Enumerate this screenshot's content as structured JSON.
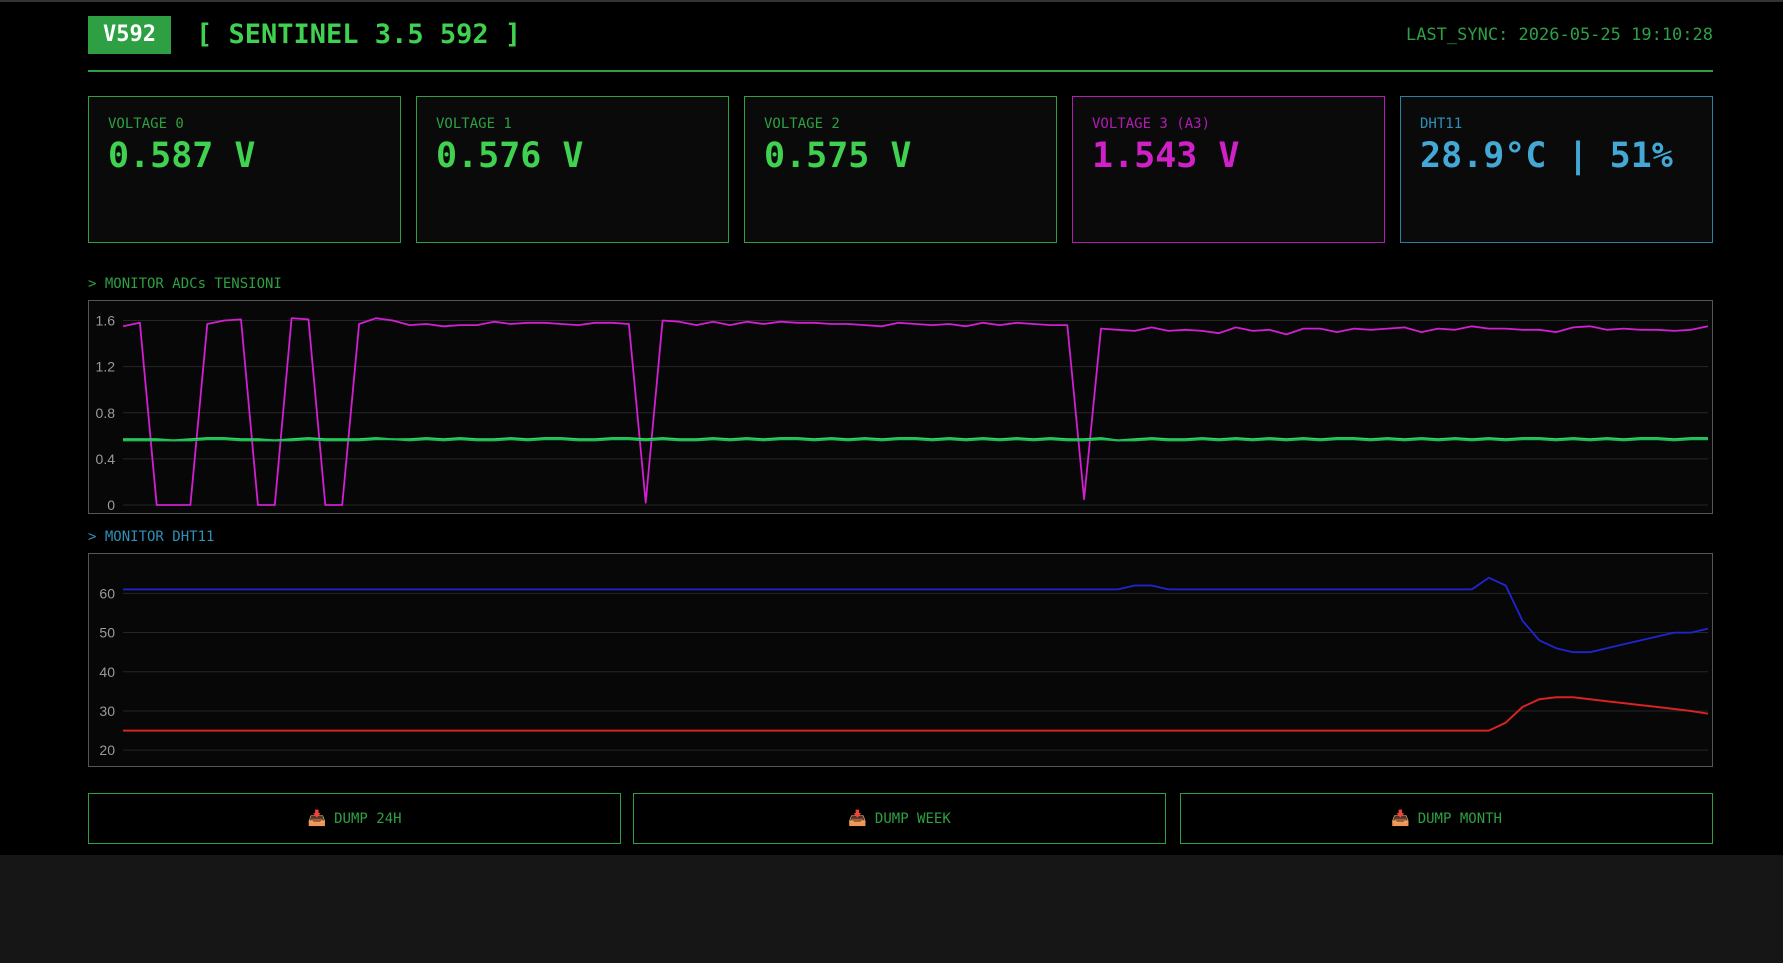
{
  "header": {
    "badge": "V592",
    "title": "[ SENTINEL 3.5 592 ]",
    "sync": "LAST_SYNC: 2026-05-25 19:10:28"
  },
  "cards": [
    {
      "label": "VOLTAGE 0",
      "value": "0.587 V"
    },
    {
      "label": "VOLTAGE 1",
      "value": "0.576 V"
    },
    {
      "label": "VOLTAGE 2",
      "value": "0.575 V"
    },
    {
      "label": "VOLTAGE 3 (A3)",
      "value": "1.543 V"
    },
    {
      "label": "DHT11",
      "value": "28.9°C | 51%"
    }
  ],
  "sections": {
    "adc": "> MONITOR ADCs TENSIONI",
    "dht": "> MONITOR DHT11"
  },
  "buttons": [
    {
      "label": "DUMP 24H",
      "icon": "inbox-tray-icon"
    },
    {
      "label": "DUMP WEEK",
      "icon": "inbox-tray-icon"
    },
    {
      "label": "DUMP MONTH",
      "icon": "inbox-tray-icon"
    }
  ],
  "colors": {
    "accent": "#2ea043",
    "v3": "#d11fd1",
    "dht": "#43a8d6",
    "humidity": "#2323d6",
    "temperature": "#d62323"
  },
  "chart_data": [
    {
      "type": "line",
      "ylim": [
        0,
        1.7
      ],
      "yticks": [
        0,
        0.4,
        0.8,
        1.2,
        1.6
      ],
      "grid": true,
      "series": [
        {
          "color": "#d11fd1",
          "values": [
            1.55,
            1.58,
            0.0,
            0.0,
            0.0,
            1.57,
            1.6,
            1.61,
            0.0,
            0.0,
            1.62,
            1.61,
            0.0,
            0.0,
            1.57,
            1.62,
            1.6,
            1.56,
            1.57,
            1.55,
            1.56,
            1.56,
            1.59,
            1.57,
            1.58,
            1.58,
            1.57,
            1.56,
            1.58,
            1.58,
            1.57,
            0.02,
            1.6,
            1.59,
            1.56,
            1.59,
            1.56,
            1.59,
            1.57,
            1.59,
            1.58,
            1.58,
            1.57,
            1.57,
            1.56,
            1.55,
            1.58,
            1.57,
            1.56,
            1.57,
            1.55,
            1.58,
            1.56,
            1.58,
            1.57,
            1.56,
            1.56,
            0.05,
            1.53,
            1.52,
            1.51,
            1.54,
            1.51,
            1.52,
            1.51,
            1.49,
            1.54,
            1.51,
            1.52,
            1.48,
            1.53,
            1.53,
            1.5,
            1.53,
            1.52,
            1.53,
            1.54,
            1.5,
            1.53,
            1.52,
            1.55,
            1.53,
            1.53,
            1.52,
            1.52,
            1.5,
            1.54,
            1.55,
            1.52,
            1.53,
            1.52,
            1.52,
            1.51,
            1.52,
            1.55
          ]
        },
        {
          "color": "#2ee05a",
          "values": [
            0.57,
            0.57,
            0.57,
            0.56,
            0.57,
            0.58,
            0.58,
            0.57,
            0.57,
            0.56,
            0.57,
            0.58,
            0.57,
            0.57,
            0.57,
            0.58,
            0.57,
            0.57,
            0.58,
            0.57,
            0.58,
            0.57,
            0.57,
            0.58,
            0.57,
            0.58,
            0.58,
            0.57,
            0.57,
            0.58,
            0.58,
            0.57,
            0.58,
            0.57,
            0.57,
            0.58,
            0.57,
            0.58,
            0.57,
            0.58,
            0.58,
            0.57,
            0.58,
            0.57,
            0.58,
            0.57,
            0.58,
            0.58,
            0.57,
            0.58,
            0.57,
            0.58,
            0.57,
            0.58,
            0.57,
            0.58,
            0.57,
            0.57,
            0.58,
            0.56,
            0.57,
            0.58,
            0.57,
            0.57,
            0.58,
            0.57,
            0.58,
            0.57,
            0.58,
            0.57,
            0.58,
            0.57,
            0.58,
            0.58,
            0.57,
            0.58,
            0.57,
            0.58,
            0.57,
            0.58,
            0.57,
            0.58,
            0.57,
            0.58,
            0.58,
            0.57,
            0.58,
            0.57,
            0.58,
            0.57,
            0.58,
            0.58,
            0.57,
            0.58,
            0.58
          ]
        },
        {
          "color": "#1fb85a",
          "values": [
            0.56,
            0.56,
            0.56,
            0.56,
            0.56,
            0.57,
            0.57,
            0.56,
            0.56,
            0.56,
            0.56,
            0.57,
            0.56,
            0.56,
            0.56,
            0.57,
            0.57,
            0.56,
            0.57,
            0.56,
            0.57,
            0.56,
            0.56,
            0.57,
            0.56,
            0.57,
            0.57,
            0.56,
            0.56,
            0.57,
            0.57,
            0.56,
            0.57,
            0.56,
            0.56,
            0.57,
            0.56,
            0.57,
            0.56,
            0.57,
            0.57,
            0.56,
            0.57,
            0.56,
            0.57,
            0.56,
            0.57,
            0.57,
            0.56,
            0.57,
            0.56,
            0.57,
            0.56,
            0.57,
            0.56,
            0.57,
            0.56,
            0.56,
            0.57,
            0.56,
            0.56,
            0.57,
            0.56,
            0.56,
            0.57,
            0.56,
            0.57,
            0.56,
            0.57,
            0.56,
            0.57,
            0.56,
            0.57,
            0.57,
            0.56,
            0.57,
            0.56,
            0.57,
            0.56,
            0.57,
            0.56,
            0.57,
            0.56,
            0.57,
            0.57,
            0.56,
            0.57,
            0.56,
            0.57,
            0.56,
            0.57,
            0.57,
            0.56,
            0.57,
            0.57
          ]
        }
      ]
    },
    {
      "type": "line",
      "ylim": [
        18,
        68
      ],
      "yticks": [
        20,
        30,
        40,
        50,
        60
      ],
      "grid": true,
      "series": [
        {
          "color": "#2323d6",
          "values": [
            61,
            61,
            61,
            61,
            61,
            61,
            61,
            61,
            61,
            61,
            61,
            61,
            61,
            61,
            61,
            61,
            61,
            61,
            61,
            61,
            61,
            61,
            61,
            61,
            61,
            61,
            61,
            61,
            61,
            61,
            61,
            61,
            61,
            61,
            61,
            61,
            61,
            61,
            61,
            61,
            61,
            61,
            61,
            61,
            61,
            61,
            61,
            61,
            61,
            61,
            61,
            61,
            61,
            61,
            61,
            61,
            61,
            61,
            61,
            61,
            62,
            62,
            61,
            61,
            61,
            61,
            61,
            61,
            61,
            61,
            61,
            61,
            61,
            61,
            61,
            61,
            61,
            61,
            61,
            61,
            61,
            64,
            62,
            53,
            48,
            46,
            45,
            45,
            46,
            47,
            48,
            49,
            50,
            50,
            51
          ]
        },
        {
          "color": "#d62323",
          "values": [
            25,
            25,
            25,
            25,
            25,
            25,
            25,
            25,
            25,
            25,
            25,
            25,
            25,
            25,
            25,
            25,
            25,
            25,
            25,
            25,
            25,
            25,
            25,
            25,
            25,
            25,
            25,
            25,
            25,
            25,
            25,
            25,
            25,
            25,
            25,
            25,
            25,
            25,
            25,
            25,
            25,
            25,
            25,
            25,
            25,
            25,
            25,
            25,
            25,
            25,
            25,
            25,
            25,
            25,
            25,
            25,
            25,
            25,
            25,
            25,
            25,
            25,
            25,
            25,
            25,
            25,
            25,
            25,
            25,
            25,
            25,
            25,
            25,
            25,
            25,
            25,
            25,
            25,
            25,
            25,
            25,
            25,
            27,
            31,
            33,
            33.5,
            33.5,
            33,
            32.5,
            32,
            31.5,
            31,
            30.5,
            30,
            29.3
          ]
        }
      ]
    }
  ]
}
